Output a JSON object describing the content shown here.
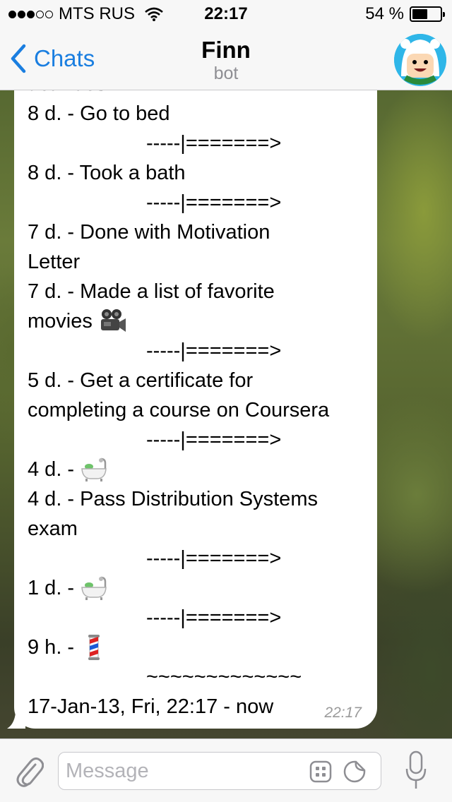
{
  "status_bar": {
    "carrier": "MTS RUS",
    "time": "22:17",
    "battery_percent_label": "54 %",
    "battery_level": 0.54,
    "signal_bars_filled": 3,
    "signal_bars_total": 5
  },
  "nav": {
    "back_label": "Chats",
    "title": "Finn",
    "subtitle": "bot",
    "avatar_icon": "finn-avatar-icon"
  },
  "message": {
    "lines": [
      {
        "text": "activities",
        "kind": "text"
      },
      {
        "text": "8 d. - Go to bed",
        "kind": "text"
      },
      {
        "text": "-----|=======>",
        "kind": "separator"
      },
      {
        "text": "8 d. - Took a bath",
        "kind": "text"
      },
      {
        "text": "-----|=======>",
        "kind": "separator"
      },
      {
        "text": "7 d. - Done with Motivation",
        "kind": "text"
      },
      {
        "text": "Letter",
        "kind": "text"
      },
      {
        "text": "7 d. - Made a list of favorite",
        "kind": "text"
      },
      {
        "text": "movies",
        "kind": "text",
        "emoji": "movie-camera-icon"
      },
      {
        "text": "-----|=======>",
        "kind": "separator"
      },
      {
        "text": "5 d. - Get a certificate for",
        "kind": "text"
      },
      {
        "text": "completing a course on Coursera",
        "kind": "text"
      },
      {
        "text": "-----|=======>",
        "kind": "separator"
      },
      {
        "text": "4 d. -",
        "kind": "text",
        "emoji": "bathtub-icon"
      },
      {
        "text": "4 d. - Pass Distribution Systems",
        "kind": "text"
      },
      {
        "text": "exam",
        "kind": "text"
      },
      {
        "text": "-----|=======>",
        "kind": "separator"
      },
      {
        "text": "1 d. -",
        "kind": "text",
        "emoji": "bathtub-icon"
      },
      {
        "text": "-----|=======>",
        "kind": "separator"
      },
      {
        "text": "9 h. -",
        "kind": "text",
        "emoji": "barber-pole-icon"
      },
      {
        "text": "~~~~~~~~~~~~~",
        "kind": "separator"
      },
      {
        "text": "17-Jan-13, Fri, 22:17 - now",
        "kind": "text"
      }
    ],
    "timestamp": "22:17"
  },
  "input_bar": {
    "placeholder": "Message",
    "value": ""
  },
  "colors": {
    "accent": "#1a7ee0",
    "bar_background": "#f7f7f7",
    "bubble": "#ffffff"
  }
}
